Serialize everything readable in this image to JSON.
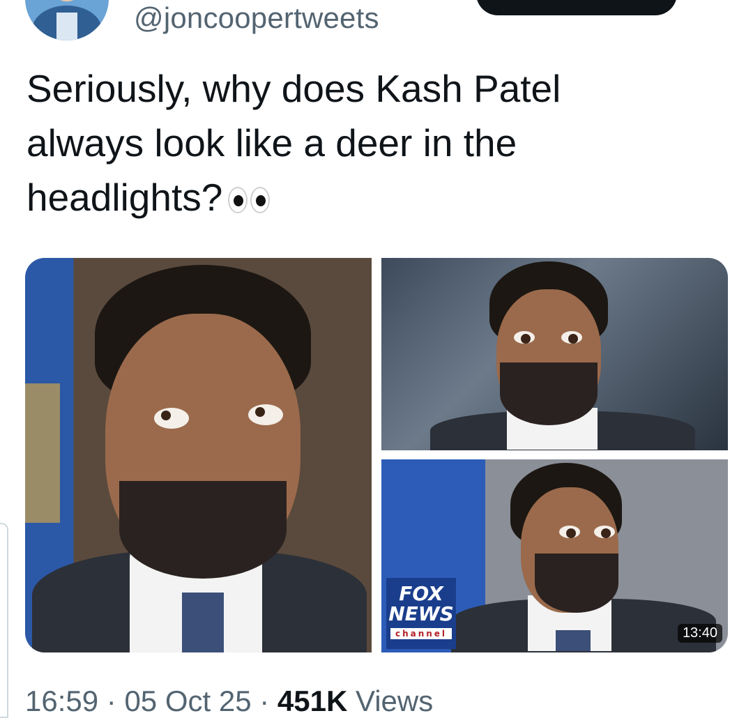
{
  "header": {
    "handle": "@joncoopertweets"
  },
  "tweet": {
    "text": "Seriously, why does Kash Patel always look like a deer in the headlights?",
    "emoji_icon": "eyes-icon"
  },
  "media": {
    "video_duration": "13:40",
    "logo": {
      "line1": "FOX",
      "line2": "NEWS",
      "line3": "channel"
    }
  },
  "meta": {
    "time": "16:59",
    "separator": " · ",
    "date": "05 Oct 25",
    "views_count": "451K",
    "views_label": "Views"
  },
  "colors": {
    "text_primary": "#0f1419",
    "text_secondary": "#536471",
    "button_dark": "#0f1419"
  }
}
